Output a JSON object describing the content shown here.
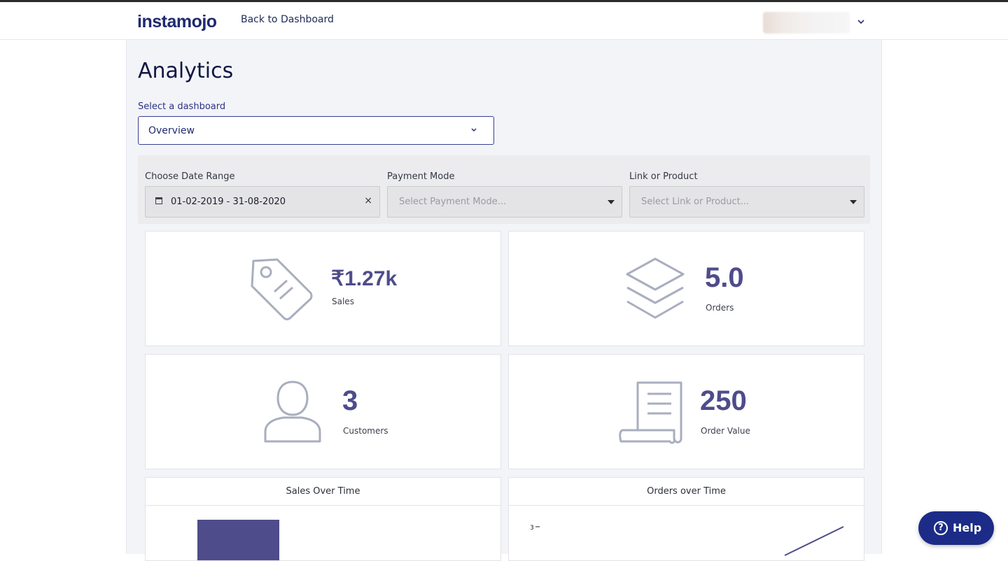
{
  "header": {
    "logo_text": "instamojo",
    "back_link": "Back to Dashboard"
  },
  "page": {
    "title": "Analytics",
    "select_label": "Select a dashboard",
    "selected_dashboard": "Overview"
  },
  "filters": {
    "date_label": "Choose Date Range",
    "date_value": "01-02-2019 - 31-08-2020",
    "payment_label": "Payment Mode",
    "payment_placeholder": "Select Payment Mode...",
    "product_label": "Link or Product",
    "product_placeholder": "Select Link or Product..."
  },
  "stats": {
    "sales": {
      "value": "₹1.27k",
      "label": "Sales",
      "icon": "price-tag-icon"
    },
    "orders": {
      "value": "5.0",
      "label": "Orders",
      "icon": "layers-icon"
    },
    "customers": {
      "value": "3",
      "label": "Customers",
      "icon": "user-icon"
    },
    "order_value": {
      "value": "250",
      "label": "Order Value",
      "icon": "receipt-icon"
    }
  },
  "charts": {
    "sales_title": "Sales Over Time",
    "orders_title": "Orders over Time",
    "orders_ytick": "3"
  },
  "help": {
    "label": "Help"
  },
  "colors": {
    "accent": "#4e4c8a",
    "brand": "#1f2a6e",
    "help_bg": "#1b2b87"
  }
}
